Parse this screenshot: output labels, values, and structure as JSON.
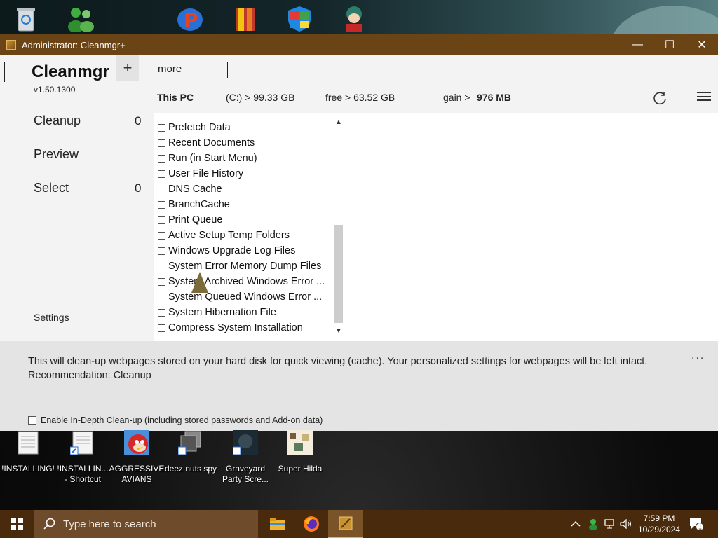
{
  "desktop_top_icons": [
    "recycle-bin-icon",
    "messenger-icon",
    "p-app-icon",
    "archive-icon",
    "windows-shield-icon",
    "anime-character-icon"
  ],
  "window": {
    "title": "Administrator: Cleanmgr+",
    "minimize": "—",
    "maximize": "☐",
    "close": "✕"
  },
  "app": {
    "name": "Cleanmgr",
    "version": "v1.50.1300",
    "add_tab": "+",
    "more_tab": "more"
  },
  "infobar": {
    "pc": "This PC",
    "drive": "(C:) > 99.33 GB",
    "free": "free >  63.52 GB",
    "gain_label": "gain >",
    "gain_value": "976 MB"
  },
  "nav": {
    "cleanup": "Cleanup",
    "cleanup_count": "0",
    "preview": "Preview",
    "select": "Select",
    "select_count": "0",
    "settings": "Settings"
  },
  "items": [
    "Prefetch Data",
    "Recent Documents",
    "Run (in Start Menu)",
    "User File History",
    "DNS Cache",
    "BranchCache",
    "Print Queue",
    "Active Setup Temp Folders",
    "Windows Upgrade Log Files",
    "System Error Memory Dump Files",
    "System Archived Windows Error ...",
    "System Queued Windows Error ...",
    "System Hibernation File",
    "Compress System Installation"
  ],
  "description": {
    "line1": "This will clean-up webpages stored on your hard disk for quick viewing (cache). Your personalized settings for webpages will be left intact.",
    "line2": "Recommendation: Cleanup",
    "more": "..."
  },
  "indepth_label": "Enable In-Depth Clean-up (including stored passwords and Add-on data)",
  "desktop_icons": [
    {
      "label": "!INSTALLING!"
    },
    {
      "label": "!INSTALLIN... - Shortcut"
    },
    {
      "label": "AGGRESSIVE AVIANS"
    },
    {
      "label": "deez nuts spy"
    },
    {
      "label": "Graveyard Party Scre..."
    },
    {
      "label": "Super Hilda"
    }
  ],
  "taskbar": {
    "search_placeholder": "Type here to search",
    "time": "7:59 PM",
    "date": "10/29/2024",
    "notification_count": "1"
  }
}
